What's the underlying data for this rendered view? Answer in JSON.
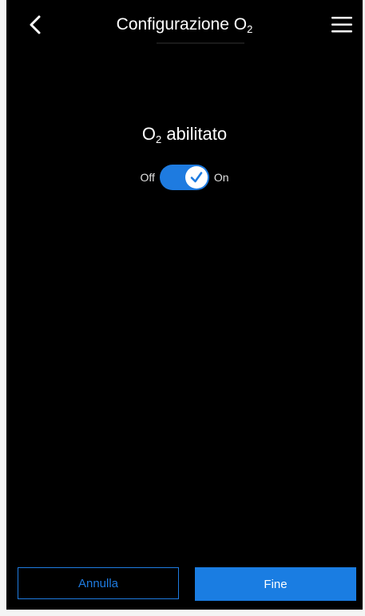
{
  "header": {
    "title_main": "Configurazione O",
    "title_sub": "2",
    "back_icon": "chevron-left-icon",
    "menu_icon": "hamburger-menu-icon"
  },
  "content": {
    "heading_main": "O",
    "heading_sub": "2",
    "heading_rest": " abilitato",
    "toggle": {
      "off_label": "Off",
      "on_label": "On",
      "state": "on",
      "check_icon": "checkmark-icon"
    }
  },
  "footer": {
    "cancel_label": "Annulla",
    "done_label": "Fine"
  },
  "colors": {
    "background": "#000000",
    "accent": "#1e7be0",
    "text": "#ffffff"
  }
}
